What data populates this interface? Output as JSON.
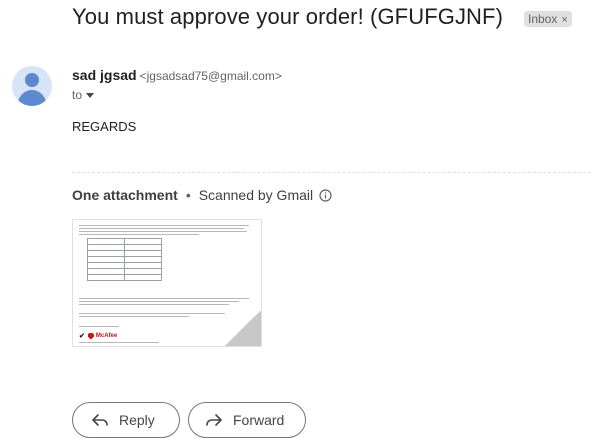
{
  "email": {
    "subject": "You must approve your order! (GFUFGJNF)",
    "label": "Inbox",
    "label_close": "×",
    "sender_name": "sad jgsad",
    "sender_email": "<jgsadsad75@gmail.com>",
    "to_label": "to",
    "body": "REGARDS"
  },
  "attachments": {
    "title": "One attachment",
    "separator": "•",
    "scan_status": "Scanned by Gmail"
  },
  "thumbnail": {
    "brand": "McAfee"
  },
  "actions": {
    "reply_label": "Reply",
    "forward_label": "Forward"
  }
}
